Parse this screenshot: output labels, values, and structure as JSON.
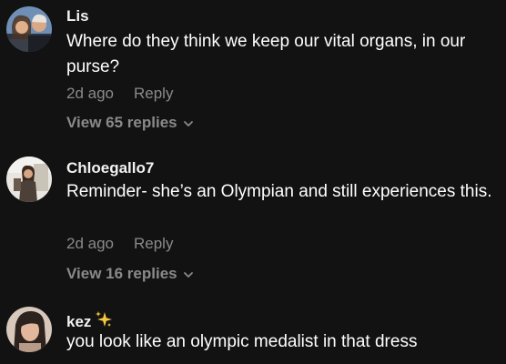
{
  "comments": [
    {
      "username": "Lis",
      "text": "Where do they think we keep our vital organs, in our purse?",
      "time": "2d ago",
      "reply_label": "Reply",
      "replies_label": "View 65 replies"
    },
    {
      "username": "Chloegallo7",
      "text": "Reminder- she’s an Olympian and still experiences this.",
      "time": "2d ago",
      "reply_label": "Reply",
      "replies_label": "View 16 replies"
    },
    {
      "username": "kez",
      "badge_icon": "sparkles-icon",
      "text": "you look like an olympic medalist in that dress"
    }
  ],
  "colors": {
    "background": "#121212",
    "secondary_text": "#8a8a8a",
    "sparkle": "#f5c842"
  }
}
